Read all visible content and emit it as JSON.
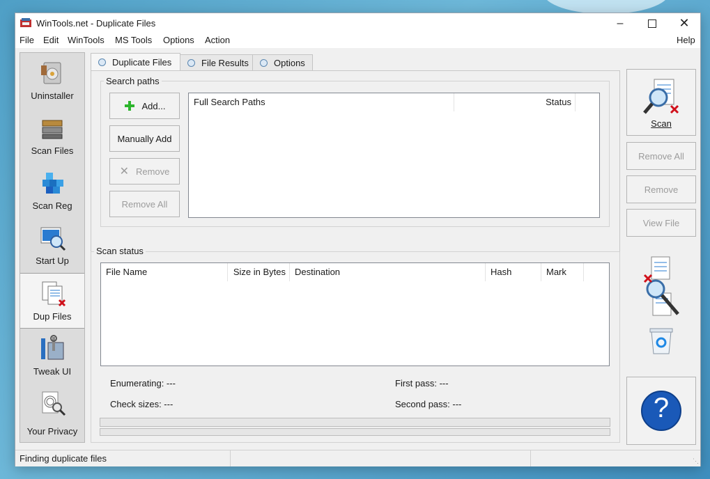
{
  "window": {
    "title": "WinTools.net - Duplicate Files"
  },
  "menu": {
    "items": [
      "File",
      "Edit",
      "WinTools",
      "MS Tools",
      "Options",
      "Action"
    ],
    "help": "Help"
  },
  "sidebar": {
    "items": [
      {
        "label": "Uninstaller",
        "icon": "uninstaller-icon"
      },
      {
        "label": "Scan Files",
        "icon": "scan-files-icon"
      },
      {
        "label": "Scan Reg",
        "icon": "scan-reg-icon"
      },
      {
        "label": "Start Up",
        "icon": "startup-icon"
      },
      {
        "label": "Dup Files",
        "icon": "dup-files-icon",
        "active": true
      },
      {
        "label": "Tweak UI",
        "icon": "tweak-ui-icon"
      },
      {
        "label": "Your Privacy",
        "icon": "privacy-icon"
      }
    ]
  },
  "tabs": [
    {
      "label": "Duplicate Files",
      "active": true
    },
    {
      "label": "File Results"
    },
    {
      "label": "Options"
    }
  ],
  "search_paths": {
    "title": "Search paths",
    "add_label": "Add...",
    "manual_add_label": "Manually Add",
    "remove_label": "Remove",
    "remove_all_label": "Remove All",
    "columns": [
      "Full Search Paths",
      "Status"
    ]
  },
  "scan_status": {
    "title": "Scan status",
    "columns": [
      "File Name",
      "Size in Bytes",
      "Destination",
      "Hash",
      "Mark"
    ],
    "enumerating": "Enumerating: ---",
    "first_pass": "First pass: ---",
    "check_sizes": "Check sizes: ---",
    "second_pass": "Second pass: ---"
  },
  "right_panel": {
    "scan_label": "Scan",
    "remove_all_label": "Remove All",
    "remove_label": "Remove",
    "view_file_label": "View File",
    "help_glyph": "?"
  },
  "status_bar": {
    "text": "Finding duplicate files"
  },
  "colors": {
    "accent": "#1b5fbf",
    "help_circle": "#1a59b8",
    "disabled_text": "#9c9c9c"
  }
}
